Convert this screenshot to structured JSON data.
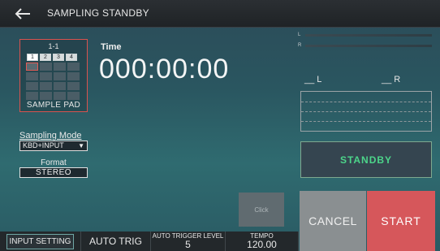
{
  "header": {
    "title": "SAMPLING STANDBY"
  },
  "sample_pad": {
    "bank": "1-1",
    "tabs": [
      "1",
      "2",
      "3",
      "4"
    ],
    "active_tab_index": 0,
    "label": "SAMPLE PAD"
  },
  "time": {
    "label": "Time",
    "value": "000:00:00"
  },
  "sampling_mode": {
    "label": "Sampling Mode",
    "value": "KBD+INPUT"
  },
  "format": {
    "label": "Format",
    "value": "STEREO"
  },
  "meter": {
    "ch_l": "L",
    "ch_r": "R",
    "left_label": "L",
    "right_label": "R"
  },
  "status": {
    "standby": "STANDBY"
  },
  "buttons": {
    "click": "Click",
    "cancel": "CANCEL",
    "start": "START"
  },
  "bottom_bar": {
    "input_setting": "INPUT SETTING",
    "auto_trig": "AUTO TRIG",
    "auto_trigger_level_label": "AUTO TRIGGER LEVEL",
    "auto_trigger_level_value": "5",
    "tempo_label": "TEMPO",
    "tempo_value": "120.00"
  },
  "colors": {
    "accent_red": "#d6575b",
    "standby_green": "#4cd58a",
    "pad_border": "#d9534f"
  },
  "icons": {
    "back": "back-arrow-icon",
    "dropdown": "dropdown-arrow-icon"
  }
}
